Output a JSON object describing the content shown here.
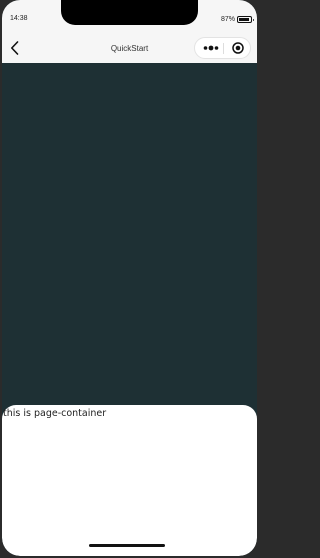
{
  "status_bar": {
    "time": "14:38",
    "battery_percent": "87%"
  },
  "nav_bar": {
    "title": "QuickStart",
    "back_icon": "chevron-left-icon",
    "more_icon": "more-dots-icon",
    "close_icon": "record-circle-icon"
  },
  "page_container": {
    "text": "this is page-container"
  },
  "colors": {
    "overlay_background": "#1e3034",
    "nav_background": "#f6f6f6",
    "container_background": "#ffffff"
  }
}
